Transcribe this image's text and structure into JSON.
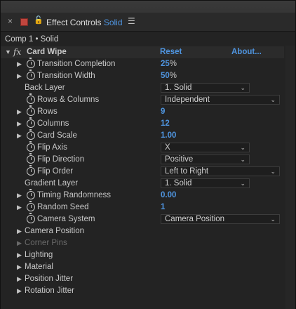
{
  "window": {
    "tab_prefix": "Effect Controls",
    "tab_layer": "Solid",
    "breadcrumb": "Comp 1 • Solid",
    "close_glyph": "×",
    "lock_glyph": "🔓",
    "menu_glyph": "☰"
  },
  "effect": {
    "name": "Card Wipe",
    "fx_glyph": "fx",
    "reset_label": "Reset",
    "about_label": "About..."
  },
  "props": {
    "transition_completion": {
      "label": "Transition Completion",
      "value": "25",
      "unit": "%"
    },
    "transition_width": {
      "label": "Transition Width",
      "value": "50",
      "unit": "%"
    },
    "back_layer": {
      "label": "Back Layer",
      "value": "1. Solid"
    },
    "rows_columns": {
      "label": "Rows & Columns",
      "value": "Independent"
    },
    "rows": {
      "label": "Rows",
      "value": "9"
    },
    "columns": {
      "label": "Columns",
      "value": "12"
    },
    "card_scale": {
      "label": "Card Scale",
      "value": "1.00"
    },
    "flip_axis": {
      "label": "Flip Axis",
      "value": "X"
    },
    "flip_direction": {
      "label": "Flip Direction",
      "value": "Positive"
    },
    "flip_order": {
      "label": "Flip Order",
      "value": "Left to Right"
    },
    "gradient_layer": {
      "label": "Gradient Layer",
      "value": "1. Solid"
    },
    "timing_randomness": {
      "label": "Timing Randomness",
      "value": "0.00"
    },
    "random_seed": {
      "label": "Random Seed",
      "value": "1"
    },
    "camera_system": {
      "label": "Camera System",
      "value": "Camera Position"
    }
  },
  "groups": {
    "camera_position": "Camera Position",
    "corner_pins": "Corner Pins",
    "lighting": "Lighting",
    "material": "Material",
    "position_jitter": "Position Jitter",
    "rotation_jitter": "Rotation Jitter"
  },
  "colors": {
    "accent": "#4f95e0",
    "background": "#232323",
    "text": "#c8c8c8",
    "disabled": "#6a6a6a",
    "label_swatch": "#c0463e"
  }
}
